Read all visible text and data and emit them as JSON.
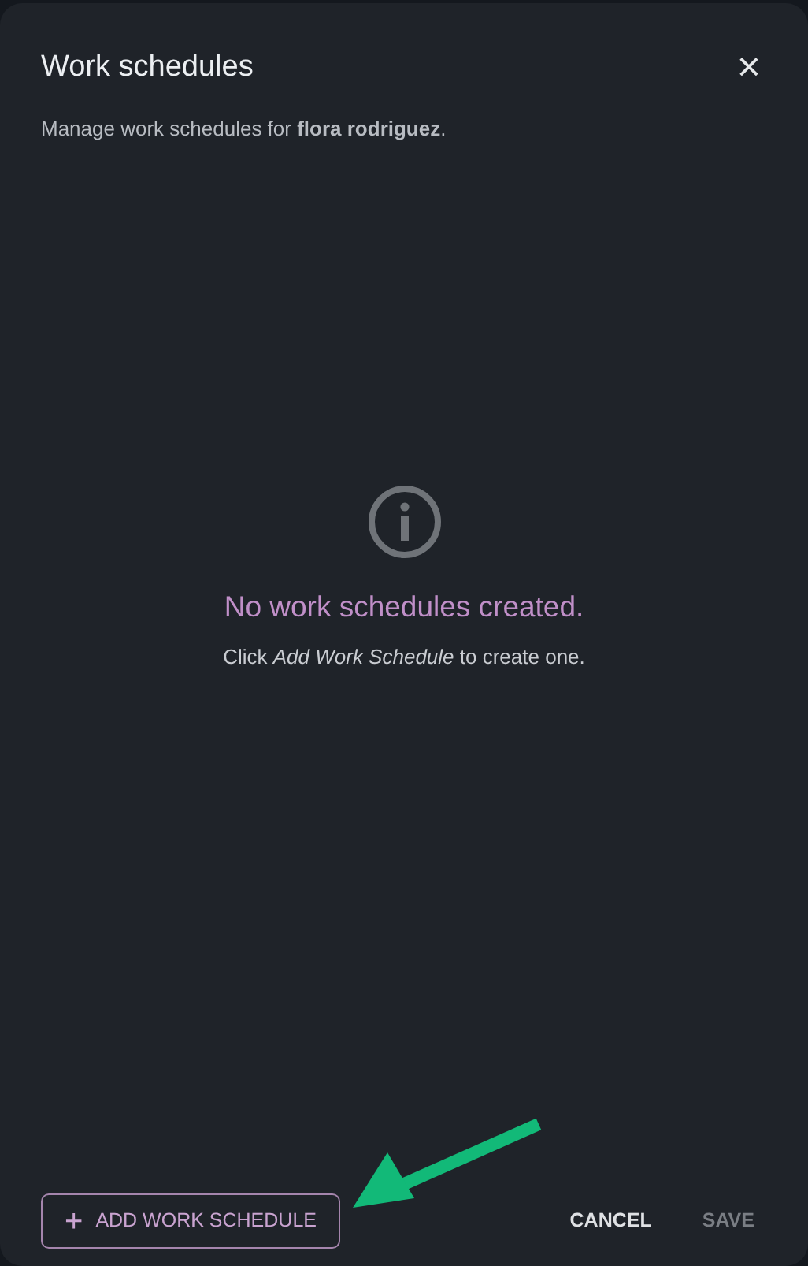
{
  "dialog": {
    "title": "Work schedules",
    "subtitle": "Manage work schedules for **flora rodriguez**.",
    "close": "×"
  },
  "empty_state": {
    "heading": "No work schedules created.",
    "hint": "Click *Add Work Schedule* to create one."
  },
  "footer": {
    "add_button": {
      "icon": "+",
      "label": "ADD WORK SCHEDULE"
    },
    "actions": [
      {
        "label": "CANCEL",
        "disabled": false
      },
      {
        "label": "SAVE",
        "disabled": true
      }
    ]
  }
}
